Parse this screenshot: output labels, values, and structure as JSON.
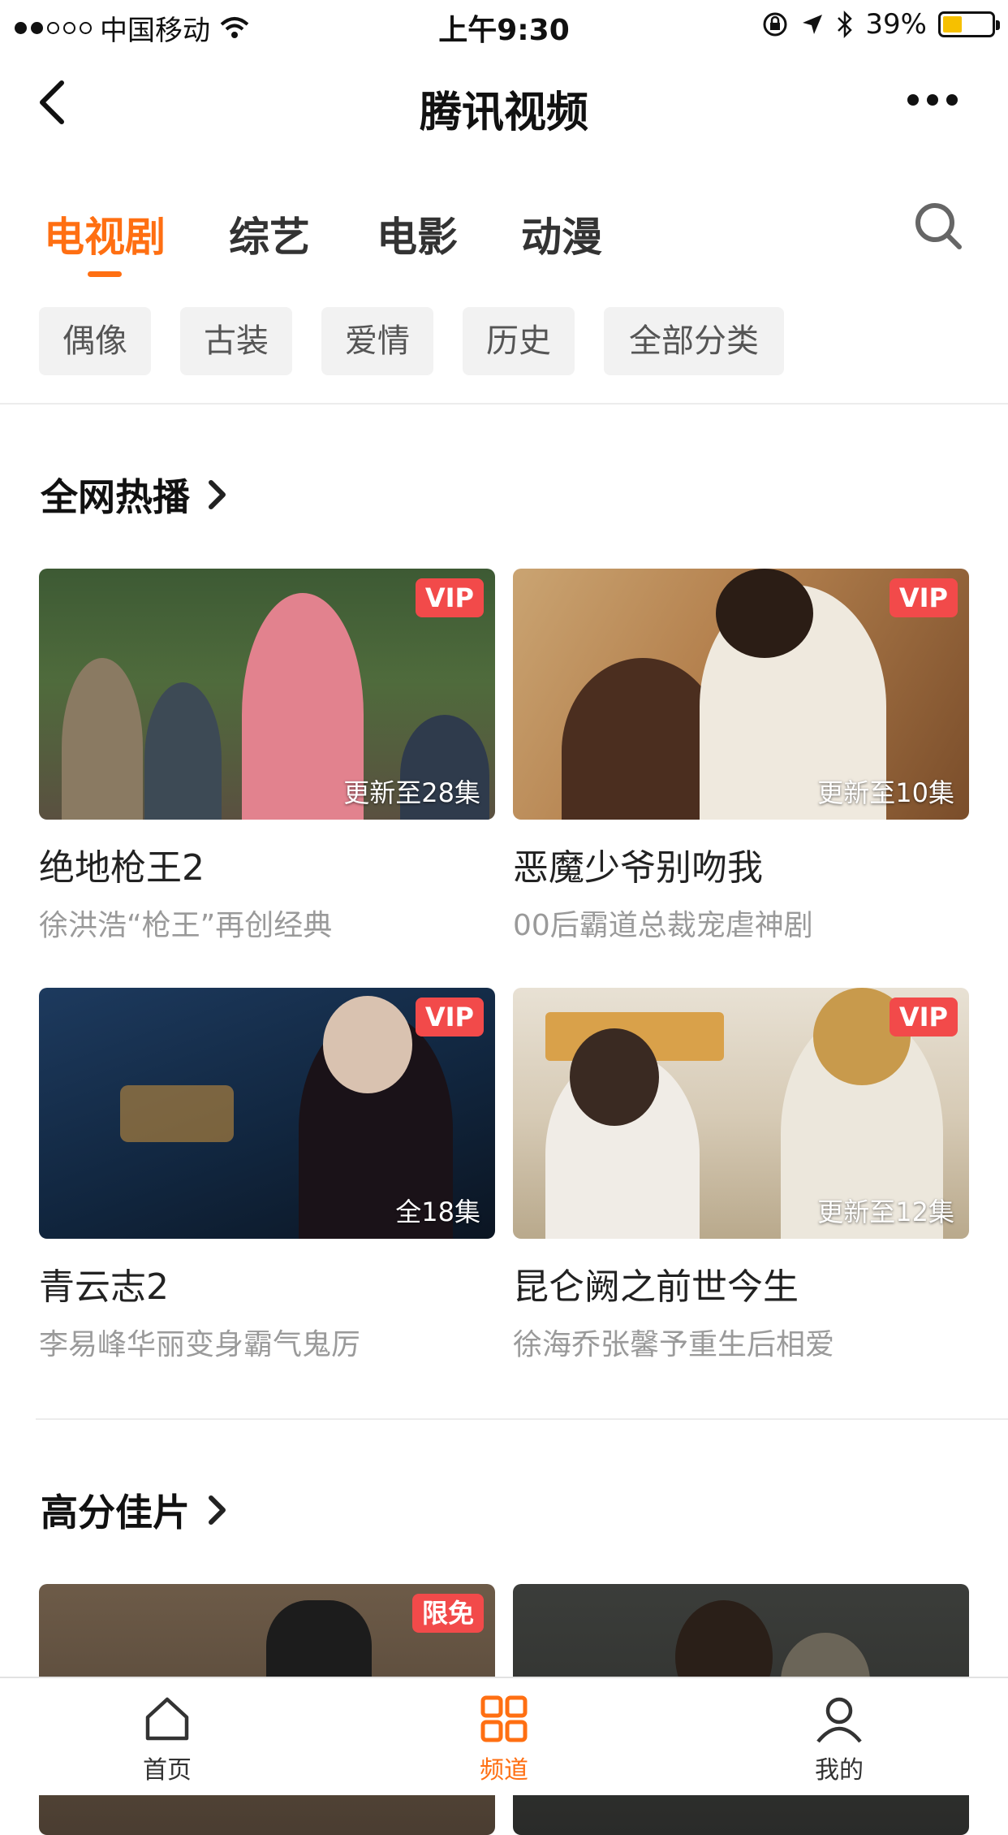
{
  "status_bar": {
    "carrier": "中国移动",
    "time": "上午9:30",
    "battery": "39%",
    "battery_level": 0.39
  },
  "nav": {
    "title": "腾讯视频",
    "back_icon": "chevron-left-icon",
    "more_icon": "more-dots-icon"
  },
  "tabs": [
    {
      "label": "电视剧",
      "active": true
    },
    {
      "label": "综艺",
      "active": false
    },
    {
      "label": "电影",
      "active": false
    },
    {
      "label": "动漫",
      "active": false
    }
  ],
  "chips": [
    "偶像",
    "古装",
    "爱情",
    "历史",
    "全部分类"
  ],
  "sections": [
    {
      "title": "全网热播",
      "cards": [
        {
          "title": "绝地枪王2",
          "subtitle": "徐洪浩“枪王”再创经典",
          "badge": "VIP",
          "episode": "更新至28集"
        },
        {
          "title": "恶魔少爷别吻我",
          "subtitle": "00后霸道总裁宠虐神剧",
          "badge": "VIP",
          "episode": "更新至10集"
        },
        {
          "title": "青云志2",
          "subtitle": "李易峰华丽变身霸气鬼厉",
          "badge": "VIP",
          "episode": "全18集"
        },
        {
          "title": "昆仑阙之前世今生",
          "subtitle": "徐海乔张馨予重生后相爱",
          "badge": "VIP",
          "episode": "更新至12集"
        }
      ]
    },
    {
      "title": "高分佳片",
      "cards": [
        {
          "badge": "限免"
        },
        {}
      ]
    }
  ],
  "tabbar": [
    {
      "label": "首页",
      "icon": "home-icon",
      "active": false
    },
    {
      "label": "频道",
      "icon": "grid-icon",
      "active": true
    },
    {
      "label": "我的",
      "icon": "user-icon",
      "active": false
    }
  ],
  "colors": {
    "accent": "#ff6f12",
    "vip_badge": "#f24a4a"
  }
}
